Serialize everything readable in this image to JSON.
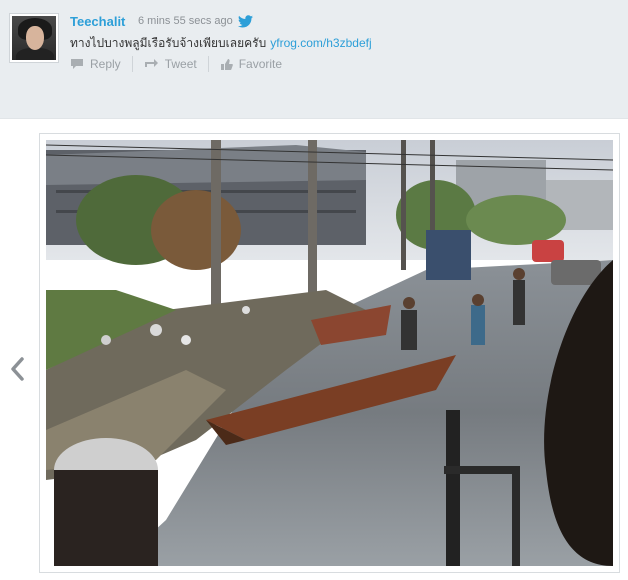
{
  "tweet": {
    "username": "Teechalit",
    "timestamp": "6 mins 55 secs ago",
    "text": "ทางไปบางพลูมีเรือรับจ้างเพียบเลยครับ",
    "link": "yfrog.com/h3zbdefj",
    "actions": {
      "reply": "Reply",
      "retweet": "Tweet",
      "favorite": "Favorite"
    }
  },
  "icons": {
    "bird": "twitter-bird-icon",
    "reply": "reply-icon",
    "retweet": "retweet-icon",
    "favorite": "favorite-icon",
    "prev": "chevron-left-icon"
  },
  "colors": {
    "header_bg": "#e9edf0",
    "link": "#2d9fd8",
    "muted": "#9aa0a5",
    "text": "#333333"
  }
}
